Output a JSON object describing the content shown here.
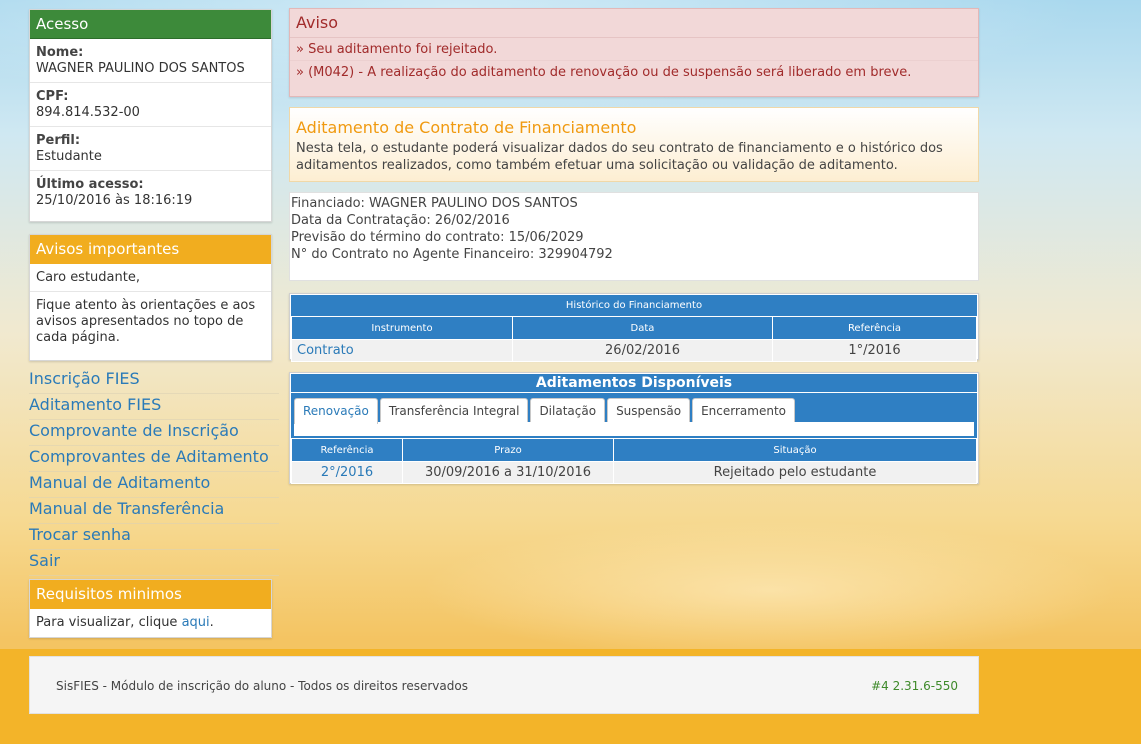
{
  "sidebar": {
    "acesso": {
      "title": "Acesso",
      "nome_label": "Nome:",
      "nome": "WAGNER PAULINO DOS SANTOS",
      "cpf_label": "CPF:",
      "cpf": "894.814.532-00",
      "perfil_label": "Perfil:",
      "perfil": "Estudante",
      "ultimo_label": "Último acesso:",
      "ultimo": "25/10/2016 às 18:16:19"
    },
    "avisos": {
      "title": "Avisos importantes",
      "greeting": "Caro estudante,",
      "text": "Fique atento às orientações e aos avisos apresentados no topo de cada página."
    },
    "nav": [
      "Inscrição FIES",
      "Aditamento FIES",
      "Comprovante de Inscrição",
      "Comprovantes de Aditamento",
      "Manual de Aditamento",
      "Manual de Transferência",
      "Trocar senha",
      "Sair"
    ],
    "requisitos": {
      "title": "Requisitos minimos",
      "text": "Para visualizar, clique ",
      "link": "aqui",
      "end": "."
    }
  },
  "alert": {
    "title": "Aviso",
    "lines": [
      "» Seu aditamento foi rejeitado.",
      "» (M042) - A realização do aditamento de renovação ou de suspensão será liberado em breve."
    ]
  },
  "info": {
    "title": "Aditamento de Contrato de Financiamento",
    "text": "Nesta tela, o estudante poderá visualizar dados do seu contrato de financiamento e o histórico dos aditamentos realizados, como também efetuar uma solicitação ou validação de aditamento."
  },
  "financiamento": {
    "financiado": "Financiado: WAGNER PAULINO DOS SANTOS",
    "data": "Data da Contratação: 26/02/2016",
    "previsao": "Previsão do término do contrato: 15/06/2029",
    "contrato": "N° do Contrato no Agente Financeiro: 329904792"
  },
  "historico": {
    "caption": "Histórico do Financiamento",
    "headers": [
      "Instrumento",
      "Data",
      "Referência"
    ],
    "row": {
      "instrumento": "Contrato",
      "data": "26/02/2016",
      "referencia": "1°/2016"
    }
  },
  "aditamentos": {
    "caption": "Aditamentos Disponíveis",
    "tabs": [
      "Renovação",
      "Transferência Integral",
      "Dilatação",
      "Suspensão",
      "Encerramento"
    ],
    "headers": [
      "Referência",
      "Prazo",
      "Situação"
    ],
    "row": {
      "referencia": "2°/2016",
      "prazo": "30/09/2016 a 31/10/2016",
      "situacao": "Rejeitado pelo estudante"
    }
  },
  "footer": {
    "text": "SisFIES - Módulo de inscrição do aluno - Todos os direitos reservados",
    "version": "#4 2.31.6-550"
  },
  "colors": {
    "accent_blue": "#2f7fc3",
    "header_green": "#3d8a3a",
    "header_orange": "#f1ad1f",
    "alert_red": "#a12b2b"
  }
}
